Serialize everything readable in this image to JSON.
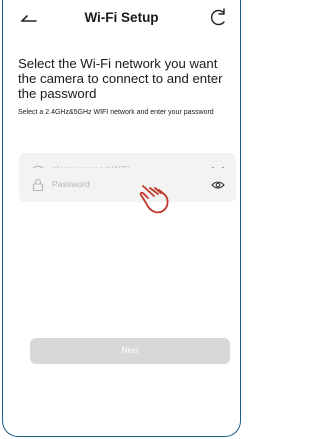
{
  "header": {
    "title": "Wi-Fi Setup",
    "back_icon": "back-arrow-icon",
    "refresh_icon": "refresh-icon"
  },
  "main": {
    "heading": "Select the Wi-Fi network you want the camera to connect to and enter the password",
    "subtext": "Select a 2.4GHz&5GHz WIFI network and enter your password"
  },
  "wifi_field": {
    "placeholder": "please connect WiFi",
    "icon": "wifi-icon",
    "dropdown_icon": "chevron-down-icon"
  },
  "password_field": {
    "placeholder": "Password",
    "icon": "lock-icon",
    "visibility_icon": "eye-icon"
  },
  "next_button": {
    "label": "Next",
    "enabled": false
  },
  "colors": {
    "frame_border": "#1d5f8a",
    "field_bg": "#f3f3f3",
    "placeholder": "#b5b5b5",
    "button_disabled": "#d8d8d8",
    "pointer_hand": "#c0392b"
  }
}
